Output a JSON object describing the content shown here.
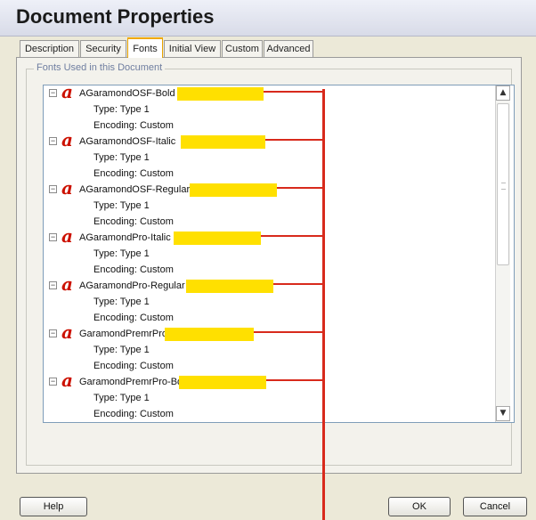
{
  "window": {
    "title": "Document Properties"
  },
  "tabs": [
    {
      "label": "Description",
      "active": false
    },
    {
      "label": "Security",
      "active": false
    },
    {
      "label": "Fonts",
      "active": true
    },
    {
      "label": "Initial View",
      "active": false
    },
    {
      "label": "Custom",
      "active": false
    },
    {
      "label": "Advanced",
      "active": false
    }
  ],
  "fonts_group": {
    "label": "Fonts Used in this Document"
  },
  "fonts": [
    {
      "name": "AGaramondOSF-Bold",
      "type": "Type: Type 1",
      "encoding": "Encoding: Custom"
    },
    {
      "name": "AGaramondOSF-Italic",
      "type": "Type: Type 1",
      "encoding": "Encoding: Custom"
    },
    {
      "name": "AGaramondOSF-Regular",
      "type": "Type: Type 1",
      "encoding": "Encoding: Custom"
    },
    {
      "name": "AGaramondPro-Italic",
      "type": "Type: Type 1",
      "encoding": "Encoding: Custom"
    },
    {
      "name": "AGaramondPro-Regular",
      "type": "Type: Type 1",
      "encoding": "Encoding: Custom"
    },
    {
      "name": "GaramondPremrPro",
      "type": "Type: Type 1",
      "encoding": "Encoding: Custom"
    },
    {
      "name": "GaramondPremrPro-Bd",
      "type": "Type: Type 1",
      "encoding": "Encoding: Custom"
    }
  ],
  "icons": {
    "toggle": "minus-box-icon",
    "font": "type1-font-icon",
    "scroll_up": "scroll-up-arrow-icon",
    "scroll_down": "scroll-down-arrow-icon"
  },
  "colors": {
    "highlight": "#ffe000",
    "callout": "#d82a1c",
    "font_icon": "#cc1100",
    "active_tab": "#f0a800"
  },
  "buttons": {
    "help": "Help",
    "ok": "OK",
    "cancel": "Cancel"
  }
}
